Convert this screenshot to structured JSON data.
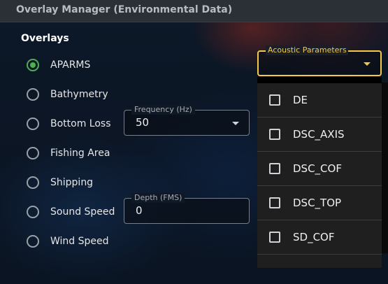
{
  "window": {
    "title": "Overlay Manager (Environmental Data)"
  },
  "overlays": {
    "title": "Overlays",
    "items": [
      {
        "label": "APARMS",
        "checked": true
      },
      {
        "label": "Bathymetry",
        "checked": false
      },
      {
        "label": "Bottom Loss",
        "checked": false
      },
      {
        "label": "Fishing Area",
        "checked": false
      },
      {
        "label": "Shipping",
        "checked": false
      },
      {
        "label": "Sound Speed",
        "checked": false
      },
      {
        "label": "Wind Speed",
        "checked": false
      }
    ]
  },
  "frequency": {
    "label": "Frequency (Hz)",
    "value": "50"
  },
  "depth": {
    "label": "Depth (FMS)",
    "value": "0"
  },
  "acoustic": {
    "label": "Acoustic Parameters",
    "options": [
      "DE",
      "DSC_AXIS",
      "DSC_COF",
      "DSC_TOP",
      "SD_COF"
    ]
  },
  "colors": {
    "accent": "#f2c94c",
    "radio_selected": "#4caf50"
  }
}
